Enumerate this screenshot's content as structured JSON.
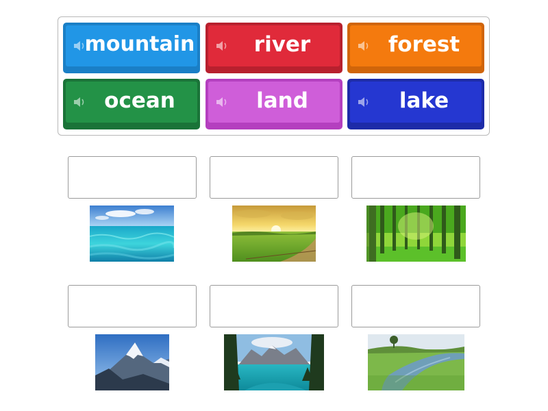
{
  "word_bank": [
    {
      "label": "mountain",
      "color": "#2196e6",
      "shade": "#1a7fc6",
      "icon": "speaker-icon"
    },
    {
      "label": "river",
      "color": "#e02a3a",
      "shade": "#b8202e",
      "icon": "speaker-icon"
    },
    {
      "label": "forest",
      "color": "#f47a0e",
      "shade": "#d0650a",
      "icon": "speaker-icon"
    },
    {
      "label": "ocean",
      "color": "#239247",
      "shade": "#1a7338",
      "icon": "speaker-icon"
    },
    {
      "label": "land",
      "color": "#cf5ed9",
      "shade": "#b43fbf",
      "icon": "speaker-icon"
    },
    {
      "label": "lake",
      "color": "#2537d1",
      "shade": "#1d2ba8",
      "icon": "speaker-icon"
    }
  ],
  "images": [
    "ocean-photo",
    "land-photo",
    "forest-photo",
    "mountain-photo",
    "lake-photo",
    "river-photo"
  ]
}
